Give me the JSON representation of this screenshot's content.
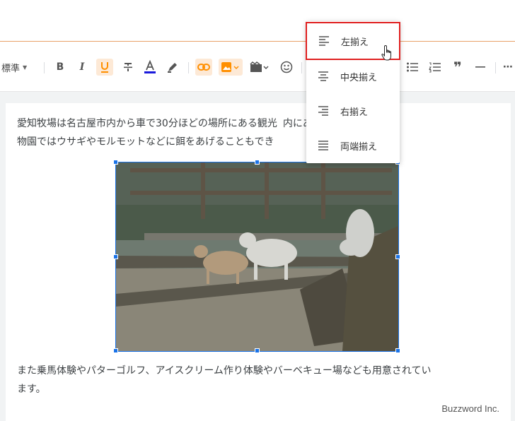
{
  "toolbar": {
    "font_style": "標準",
    "items": [
      "bold-icon",
      "italic-icon",
      "underline-icon",
      "strikethrough-icon",
      "text-color-icon",
      "highlight-icon",
      "link-icon",
      "image-icon",
      "video-icon",
      "emoji-icon",
      "bulleted-list-icon",
      "numbered-list-icon",
      "quote-icon",
      "horizontal-rule-icon",
      "more-icon"
    ],
    "active_color": "#ff8f00",
    "text_color_bar": "#1a1adb"
  },
  "align_menu": {
    "items": [
      {
        "label": "左揃え",
        "icon": "align-left-icon",
        "selected": true
      },
      {
        "label": "中央揃え",
        "icon": "align-center-icon",
        "selected": false
      },
      {
        "label": "右揃え",
        "icon": "align-right-icon",
        "selected": false
      },
      {
        "label": "両端揃え",
        "icon": "align-justify-icon",
        "selected": false
      }
    ],
    "highlight_color": "#e02020"
  },
  "editor": {
    "paragraph1_line1": "愛知牧場は名古屋市内から車で30分ほどの場所にある観光",
    "paragraph1_line1_tail": "内にあるふれあい動",
    "paragraph1_line2": "物園ではウサギやモルモットなどに餌をあげることもでき",
    "paragraph2_line1": "また乗馬体験やパターゴルフ、アイスクリーム作り体験やバーベキュー場なども用意されてい",
    "paragraph2_line2": "ます。",
    "image_alt": "goats-photo",
    "selection_color": "#1a73e8"
  },
  "watermark": "Buzzword Inc."
}
